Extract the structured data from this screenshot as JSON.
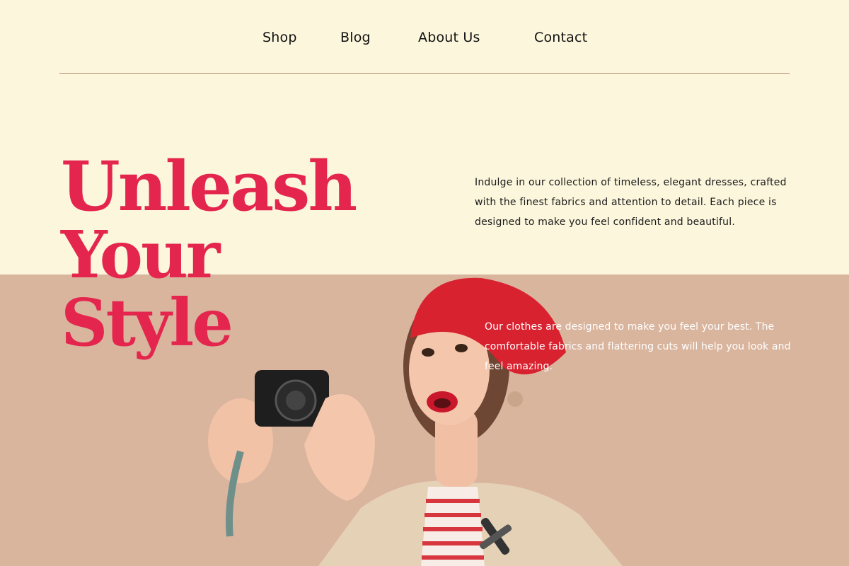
{
  "nav": {
    "items": [
      "Shop",
      "Blog",
      "About Us",
      "Contact"
    ]
  },
  "hero": {
    "headline_lines": [
      "Unleash",
      "Your",
      "Style"
    ],
    "intro": "Indulge in our collection of timeless, elegant dresses, crafted with the finest fabrics and attention to detail. Each piece is designed to make you feel confident and beautiful.",
    "secondary": "Our clothes are designed to make you feel your best. The comfortable fabrics and flattering cuts will help you look and feel amazing."
  },
  "colors": {
    "background": "#fbf6dc",
    "band": "#d9b59e",
    "accent": "#e4264e",
    "rule": "#b8906f"
  },
  "photo": {
    "description_icon": "woman-with-camera-photo"
  }
}
